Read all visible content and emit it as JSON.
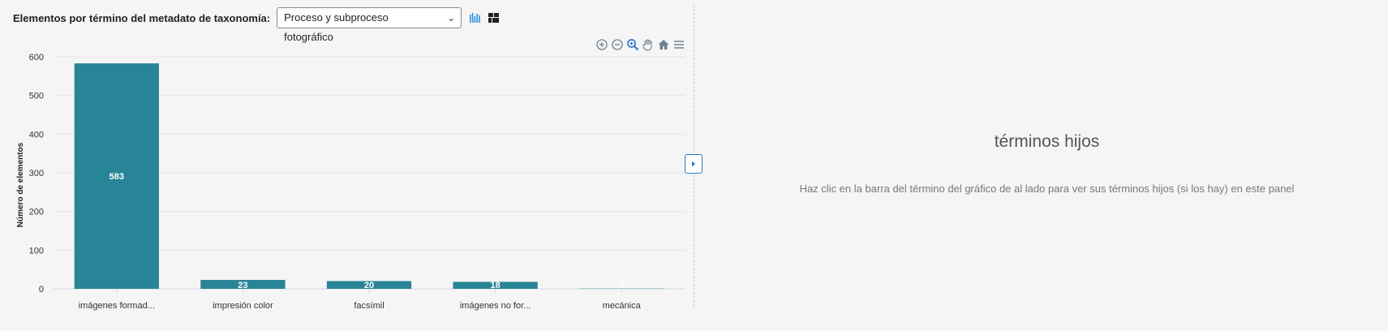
{
  "toolbar": {
    "label": "Elementos por término del metadato de taxonomía:",
    "select_value": "Proceso y subproceso fotográfico",
    "bar_chart_icon": "bar-chart-icon",
    "treemap_icon": "treemap-icon",
    "colors": {
      "bar_chart_icon": "#2f8fd8",
      "treemap_icon": "#222222"
    }
  },
  "chart_tools": [
    "zoom-in-icon",
    "zoom-out-icon",
    "zoom-selection-icon",
    "pan-hand-icon",
    "reset-home-icon",
    "menu-icon"
  ],
  "chart_data": {
    "type": "bar",
    "categories": [
      "imágenes formad...",
      "impresión color",
      "facsímil",
      "imágenes no for...",
      "mecánica"
    ],
    "values": [
      583,
      23,
      20,
      18,
      2
    ],
    "data_labels": [
      "583",
      "23",
      "20",
      "18",
      "2"
    ],
    "title": "",
    "xlabel": "",
    "ylabel": "Número de elementos",
    "ylim": [
      0,
      600
    ],
    "yticks": [
      "0",
      "100",
      "200",
      "300",
      "400",
      "500",
      "600"
    ],
    "grid": true,
    "legend": "none",
    "colors": {
      "bar": "#288597",
      "bar_light": "#a9ccd4",
      "grid": "#e3e3e3"
    }
  },
  "panel": {
    "toggle_icon": "caret-right-icon",
    "title": "términos hijos",
    "text": "Haz clic en la barra del término del gráfico de al lado para ver sus términos hijos (si los hay) en este panel"
  }
}
